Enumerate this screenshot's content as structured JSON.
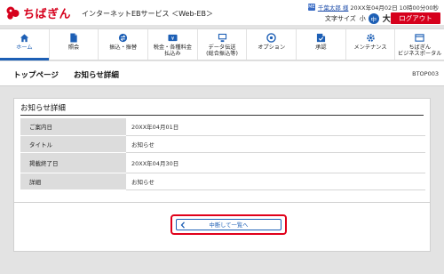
{
  "header": {
    "logo_text": "ちばぎん",
    "service_name": "インターネットEBサービス ＜Web-EB＞",
    "user_icon_label": "ME",
    "user_name": "千葉太郎 様",
    "login_time": "20XX年04月02日 10時00分00秒",
    "font_size_label": "文字サイズ",
    "font_small": "小",
    "font_medium": "中",
    "font_large": "大",
    "logout_label": "ログアウト"
  },
  "nav": {
    "items": [
      {
        "label": "ホーム",
        "icon": "home-icon"
      },
      {
        "label": "照会",
        "icon": "document-icon"
      },
      {
        "label": "振込・振替",
        "icon": "transfer-icon"
      },
      {
        "label": "税金・各種料金\n払込み",
        "icon": "yen-icon"
      },
      {
        "label": "データ伝送\n(総合振込等)",
        "icon": "data-transfer-icon"
      },
      {
        "label": "オプション",
        "icon": "option-icon"
      },
      {
        "label": "承認",
        "icon": "approval-icon"
      },
      {
        "label": "メンテナンス",
        "icon": "gear-icon"
      },
      {
        "label": "ちばぎん\nビジネスポータル",
        "icon": "portal-icon"
      }
    ]
  },
  "pagebar": {
    "top_crumb": "トップページ",
    "current": "お知らせ詳細",
    "screen_id": "BTOP003"
  },
  "detail": {
    "title": "お知らせ詳細",
    "rows": [
      {
        "label": "ご案内日",
        "value": "20XX年04月01日"
      },
      {
        "label": "タイトル",
        "value": "お知らせ"
      },
      {
        "label": "掲載終了日",
        "value": "20XX年04月30日"
      },
      {
        "label": "詳細",
        "value": "お知らせ"
      }
    ]
  },
  "actions": {
    "back_label": "中断して一覧へ"
  },
  "colors": {
    "brand_red": "#d6001c",
    "accent_blue": "#1d5fb5"
  }
}
